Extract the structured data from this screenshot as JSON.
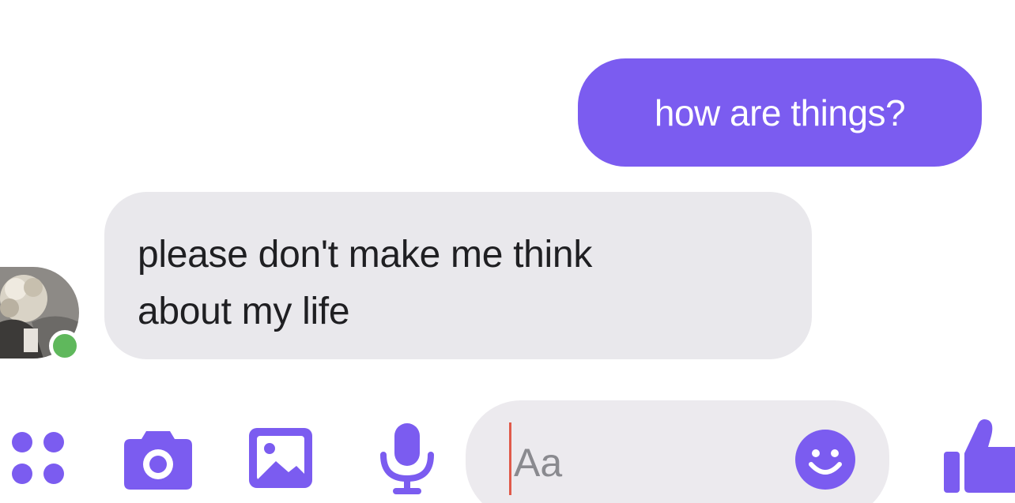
{
  "conversation": {
    "messages": [
      {
        "direction": "outgoing",
        "text": "how are things?"
      },
      {
        "direction": "incoming",
        "lines": [
          "please don't make me think",
          "about my life"
        ]
      }
    ],
    "contact": {
      "online": true
    }
  },
  "composer": {
    "input_placeholder": "Aa",
    "icons": [
      "more-apps-icon",
      "camera-icon",
      "gallery-icon",
      "microphone-icon",
      "emoji-icon",
      "thumbs-up-icon"
    ]
  },
  "colors": {
    "accent": "#7b5cf0",
    "outgoing_bubble": "#7b5cf0",
    "incoming_bubble": "#e9e8ec",
    "online_indicator": "#5fb85c"
  }
}
